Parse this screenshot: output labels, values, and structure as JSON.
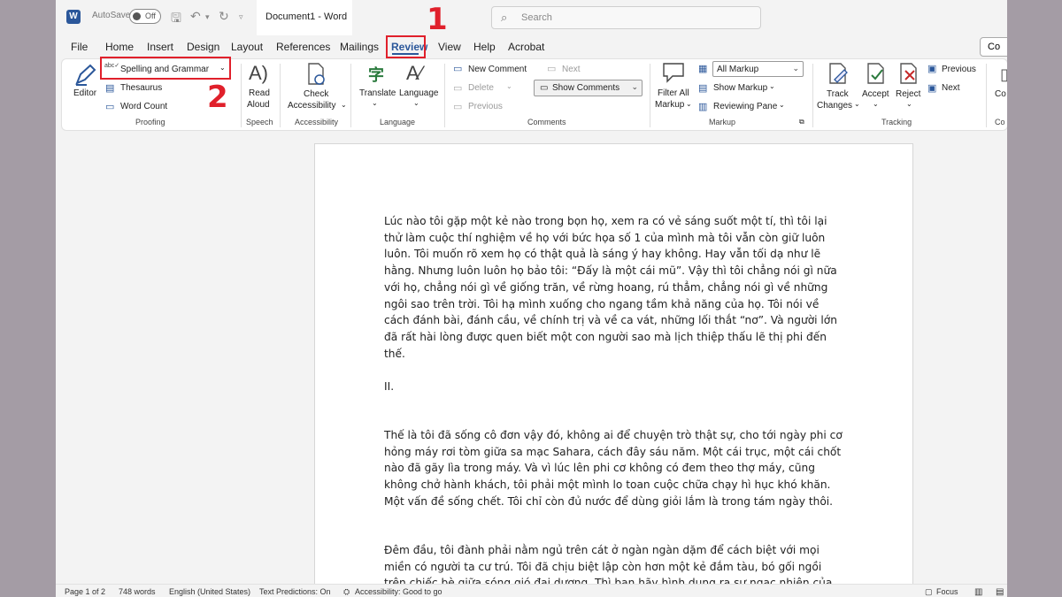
{
  "titlebar": {
    "autosave_label": "AutoSave",
    "autosave_state": "Off",
    "document_title": "Document1 - Word",
    "search_placeholder": "Search",
    "annotation_1": "1",
    "annotation_2": "2"
  },
  "menu": {
    "tabs": [
      "File",
      "Home",
      "Insert",
      "Design",
      "Layout",
      "References",
      "Mailings",
      "Review",
      "View",
      "Help",
      "Acrobat"
    ],
    "active": "Review",
    "comments_button": "Co"
  },
  "ribbon": {
    "proofing": {
      "editor": "Editor",
      "spelling": "Spelling and Grammar",
      "thesaurus": "Thesaurus",
      "word_count": "Word Count",
      "label": "Proofing"
    },
    "speech": {
      "read": "Read",
      "aloud": "Aloud",
      "label": "Speech"
    },
    "accessibility": {
      "check": "Check",
      "accessibility": "Accessibility",
      "label": "Accessibility"
    },
    "language": {
      "translate": "Translate",
      "language": "Language",
      "label": "Language"
    },
    "comments": {
      "new": "New Comment",
      "next": "Next",
      "delete": "Delete",
      "previous": "Previous",
      "show": "Show Comments",
      "label": "Comments"
    },
    "markup": {
      "filter_all": "Filter All",
      "markup_word": "Markup",
      "all_markup": "All Markup",
      "show_markup": "Show Markup",
      "reviewing_pane": "Reviewing Pane",
      "label": "Markup"
    },
    "tracking": {
      "track": "Track",
      "changes": "Changes",
      "accept": "Accept",
      "reject": "Reject",
      "previous": "Previous",
      "next": "Next",
      "label": "Tracking"
    },
    "cut_off": {
      "label1": "Co",
      "label2": "Co"
    }
  },
  "document": {
    "p1": "Lúc nào tôi gặp một kẻ nào trong bọn họ, xem ra có vẻ sáng suốt một tí, thì tôi lại thử làm cuộc thí nghiệm về họ với bức họa số 1 của mình mà tôi vẫn còn giữ luôn luôn. Tôi muốn rõ xem họ có thật quả là sáng ý hay không. Hay vẫn tối dạ như lẽ hằng. Nhưng luôn luôn họ bảo tôi: “Đấy là một cái mũ”. Vậy thì tôi chẳng nói gì nữa với họ, chẳng nói gì về giống trăn, về rừng hoang, rú thẳm, chẳng nói gì về những ngôi sao trên trời. Tôi hạ mình xuống cho ngang tầm khả năng của họ. Tôi nói về cách đánh bài, đánh cầu, về chính trị và về ca vát, những lối thắt “nơ”. Và người lớn đã rất hài lòng được quen biết một con người sao mà lịch thiệp thấu lẽ thị phi đến thế.",
    "heading": "II.",
    "p2": "Thế là tôi đã sống cô đơn vậy đó, không ai để chuyện trò thật sự, cho tới ngày phi cơ hỏng máy rơi tòm giữa sa mạc Sahara, cách đây sáu năm. Một cái trục, một cái chốt nào đã gãy lìa trong máy. Và vì lúc lên phi cơ không có đem theo thợ máy, cũng không chở hành khách, tôi phải một mình lo toan cuộc chữa chạy hì hục khó khăn. Một vấn đề sống chết. Tôi chỉ còn đủ nước để dùng giỏi lắm là trong tám ngày thôi.",
    "p3": "Đêm đầu, tôi đành phải nằm ngủ trên cát ở ngàn ngàn dặm để cách biệt với mọi miền có người ta cư trú. Tôi đã chịu biệt lập còn hơn một kẻ đắm tàu, bó gối ngồi trên chiếc bè giữa sóng gió đại dương. Thì bạn hãy hình dung ra sự ngạc nhiên của tôi, lúc bình minh"
  },
  "status": {
    "page": "Page 1 of 2",
    "words": "748 words",
    "language": "English (United States)",
    "predictions": "Text Predictions: On",
    "accessibility": "Accessibility: Good to go",
    "focus": "Focus"
  },
  "colors": {
    "accent": "#2b579a",
    "highlight_red": "#e0202b",
    "outer_bg": "#a49ca5"
  }
}
